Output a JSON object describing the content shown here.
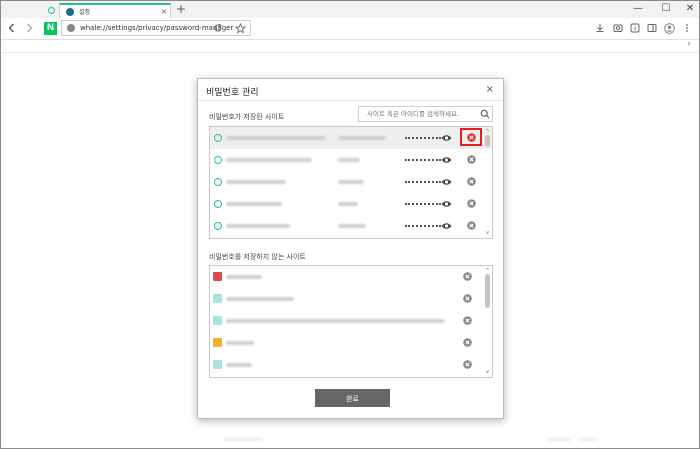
{
  "browser": {
    "tab_title": "설정",
    "tab_close": "×",
    "new_tab": "+",
    "address": "whale://settings/privacy/password-manager",
    "brand_letter": "N",
    "window_controls": [
      "—",
      "☐",
      "✕"
    ]
  },
  "dialog": {
    "title": "비밀번호 관리",
    "close": "×",
    "saved_sites_label": "비밀번호가 저장된 사이트",
    "search_placeholder": "사이트 혹은 아이디를 검색하세요.",
    "never_saved_label": "비밀번호를 저장하지 않는 사이트",
    "done_label": "완료"
  },
  "colors": {
    "accent": "#25c08c",
    "highlight": "#e02020",
    "button": "#666666"
  }
}
